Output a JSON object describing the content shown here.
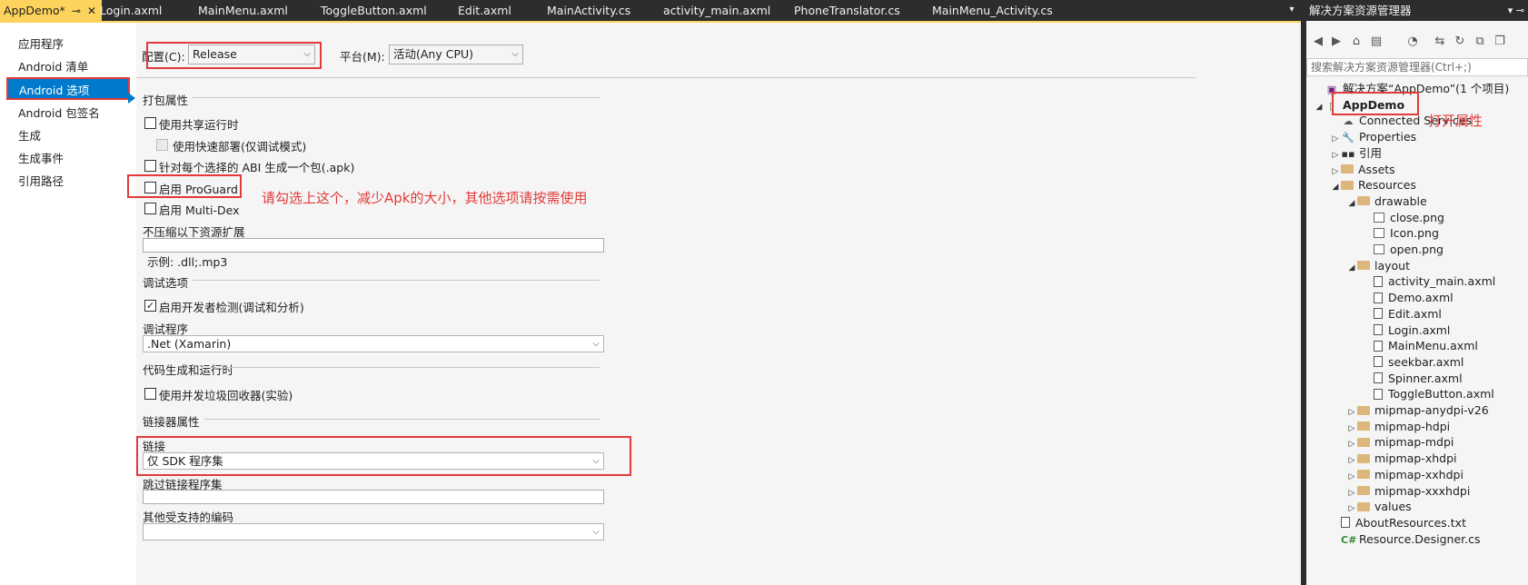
{
  "tabs": [
    {
      "label": "AppDemo*",
      "active": true
    },
    {
      "label": "Login.axml"
    },
    {
      "label": "MainMenu.axml"
    },
    {
      "label": "ToggleButton.axml"
    },
    {
      "label": "Edit.axml"
    },
    {
      "label": "MainActivity.cs"
    },
    {
      "label": "activity_main.axml"
    },
    {
      "label": "PhoneTranslator.cs"
    },
    {
      "label": "MainMenu_Activity.cs"
    }
  ],
  "tab_pin": "⊸",
  "tab_close": "✕",
  "tab_overflow": "▾",
  "leftnav": {
    "items": [
      "应用程序",
      "Android 清单",
      "Android 选项",
      "Android 包签名",
      "生成",
      "生成事件",
      "引用路径"
    ],
    "selected_index": 2
  },
  "config": {
    "config_label": "配置(C):",
    "config_value": "Release",
    "platform_label": "平台(M):",
    "platform_value": "活动(Any CPU)"
  },
  "packaging": {
    "header": "打包属性",
    "shared_runtime": "使用共享运行时",
    "fast_deploy": "使用快速部署(仅调试模式)",
    "per_abi": "针对每个选择的 ABI 生成一个包(.apk)",
    "proguard": "启用 ProGuard",
    "multidex": "启用 Multi-Dex",
    "no_compress_label": "不压缩以下资源扩展",
    "example": "示例: .dll;.mp3"
  },
  "annotation_proguard": "请勾选上这个，减少Apk的大小，其他选项请按需使用",
  "debug": {
    "header": "调试选项",
    "dev_instrumentation": "启用开发者检测(调试和分析)",
    "debugger_label": "调试程序",
    "debugger_value": ".Net (Xamarin)"
  },
  "codegen": {
    "header": "代码生成和运行时",
    "concurrent_gc": "使用并发垃圾回收器(实验)"
  },
  "linker": {
    "header": "链接器属性",
    "link_label": "链接",
    "link_value": "仅 SDK 程序集",
    "skip_label": "跳过链接程序集",
    "encodings_label": "其他受支持的编码"
  },
  "checks": {
    "shared_runtime": false,
    "fast_deploy": false,
    "per_abi": false,
    "proguard": false,
    "multidex": false,
    "dev_instrumentation": true,
    "concurrent_gc": false
  },
  "solution": {
    "title": "解决方案资源管理器",
    "title_icons": "▾ ⊸",
    "search_placeholder": "搜索解决方案资源管理器(Ctrl+;)",
    "annotation_open": "打开属性",
    "tree": [
      {
        "label": "解决方案“AppDemo”(1 个项目)",
        "kind": "solution",
        "twisty": ""
      },
      {
        "label": "AppDemo",
        "kind": "project",
        "twisty": "◢",
        "bold": true
      },
      {
        "label": "Connected Services",
        "kind": "services",
        "twisty": ""
      },
      {
        "label": "Properties",
        "kind": "wrench",
        "twisty": "▷"
      },
      {
        "label": "引用",
        "kind": "refs",
        "twisty": "▷"
      },
      {
        "label": "Assets",
        "kind": "folder",
        "twisty": "▷"
      },
      {
        "label": "Resources",
        "kind": "folder",
        "twisty": "◢"
      },
      {
        "label": "drawable",
        "kind": "folder",
        "twisty": "◢"
      },
      {
        "label": "close.png",
        "kind": "image",
        "twisty": ""
      },
      {
        "label": "Icon.png",
        "kind": "image",
        "twisty": ""
      },
      {
        "label": "open.png",
        "kind": "image",
        "twisty": ""
      },
      {
        "label": "layout",
        "kind": "folder",
        "twisty": "◢"
      },
      {
        "label": "activity_main.axml",
        "kind": "file",
        "twisty": ""
      },
      {
        "label": "Demo.axml",
        "kind": "file",
        "twisty": ""
      },
      {
        "label": "Edit.axml",
        "kind": "file",
        "twisty": ""
      },
      {
        "label": "Login.axml",
        "kind": "file",
        "twisty": ""
      },
      {
        "label": "MainMenu.axml",
        "kind": "file",
        "twisty": ""
      },
      {
        "label": "seekbar.axml",
        "kind": "file",
        "twisty": ""
      },
      {
        "label": "Spinner.axml",
        "kind": "file",
        "twisty": ""
      },
      {
        "label": "ToggleButton.axml",
        "kind": "file",
        "twisty": ""
      },
      {
        "label": "mipmap-anydpi-v26",
        "kind": "folder",
        "twisty": "▷"
      },
      {
        "label": "mipmap-hdpi",
        "kind": "folder",
        "twisty": "▷"
      },
      {
        "label": "mipmap-mdpi",
        "kind": "folder",
        "twisty": "▷"
      },
      {
        "label": "mipmap-xhdpi",
        "kind": "folder",
        "twisty": "▷"
      },
      {
        "label": "mipmap-xxhdpi",
        "kind": "folder",
        "twisty": "▷"
      },
      {
        "label": "mipmap-xxxhdpi",
        "kind": "folder",
        "twisty": "▷"
      },
      {
        "label": "values",
        "kind": "folder",
        "twisty": "▷"
      },
      {
        "label": "AboutResources.txt",
        "kind": "file",
        "twisty": ""
      },
      {
        "label": "Resource.Designer.cs",
        "kind": "cs",
        "twisty": ""
      }
    ]
  },
  "colors": {
    "accent": "#007acc",
    "active_tab": "#fcd35c",
    "annotation": "#e23a3a"
  }
}
